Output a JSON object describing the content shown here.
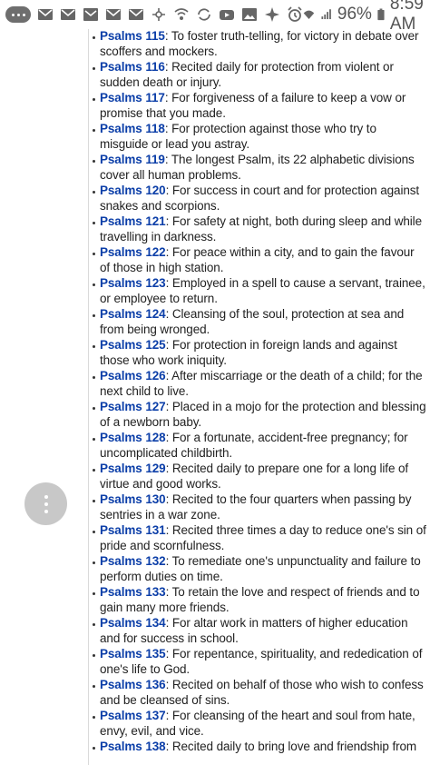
{
  "status_bar": {
    "battery": "96%",
    "time": "8:59 AM"
  },
  "psalms": [
    {
      "name": "Psalms 115",
      "desc": ": To foster truth-telling, for victory in debate over scoffers and mockers."
    },
    {
      "name": "Psalms 116",
      "desc": ": Recited daily for protection from violent or sudden death or injury."
    },
    {
      "name": "Psalms 117",
      "desc": ": For forgiveness of a failure to keep a vow or promise that you made."
    },
    {
      "name": "Psalms 118",
      "desc": ": For protection against those who try to misguide or lead you astray."
    },
    {
      "name": "Psalms 119",
      "desc": ": The longest Psalm, its 22 alphabetic divisions cover all human problems."
    },
    {
      "name": "Psalms 120",
      "desc": ": For success in court and for protection against snakes and scorpions."
    },
    {
      "name": "Psalms 121",
      "desc": ": For safety at night, both during sleep and while travelling in darkness."
    },
    {
      "name": "Psalms 122",
      "desc": ": For peace within a city, and to gain the favour of those in high station."
    },
    {
      "name": "Psalms 123",
      "desc": ": Employed in a spell to cause a servant, trainee, or employee to return."
    },
    {
      "name": "Psalms 124",
      "desc": ": Cleansing of the soul, protection at sea and from being wronged."
    },
    {
      "name": "Psalms 125",
      "desc": ": For protection in foreign lands and against those who work iniquity."
    },
    {
      "name": "Psalms 126",
      "desc": ": After miscarriage or the death of a child; for the next child to live."
    },
    {
      "name": "Psalms 127",
      "desc": ": Placed in a mojo for the protection and blessing of a newborn baby."
    },
    {
      "name": "Psalms 128",
      "desc": ": For a fortunate, accident-free pregnancy; for uncomplicated childbirth."
    },
    {
      "name": "Psalms 129",
      "desc": ": Recited daily to prepare one for a long life of virtue and good works."
    },
    {
      "name": "Psalms 130",
      "desc": ": Recited to the four quarters when passing by sentries in a war zone."
    },
    {
      "name": "Psalms 131",
      "desc": ": Recited three times a day to reduce one's sin of pride and scornfulness."
    },
    {
      "name": "Psalms 132",
      "desc": ": To remediate one's unpunctuality and failure to perform duties on time."
    },
    {
      "name": "Psalms 133",
      "desc": ": To retain the love and respect of friends and to gain many more friends."
    },
    {
      "name": "Psalms 134",
      "desc": ": For altar work in matters of higher education and for success in school."
    },
    {
      "name": "Psalms 135",
      "desc": ": For repentance, spirituality, and rededication of one's life to God."
    },
    {
      "name": "Psalms 136",
      "desc": ": Recited on behalf of those who wish to confess and be cleansed of sins."
    },
    {
      "name": "Psalms 137",
      "desc": ": For cleansing of the heart and soul from hate, envy, evil, and vice."
    },
    {
      "name": "Psalms 138",
      "desc": ": Recited daily to bring love and friendship from"
    }
  ]
}
